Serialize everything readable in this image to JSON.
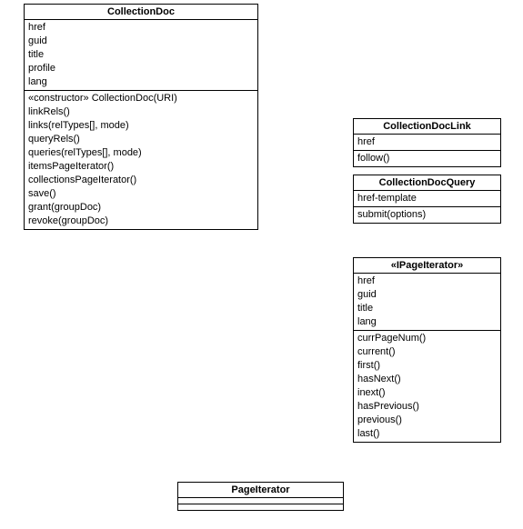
{
  "classes": {
    "collectionDoc": {
      "name": "CollectionDoc",
      "attrs": [
        "href",
        "guid",
        "title",
        "profile",
        "lang"
      ],
      "ops": [
        "«constructor» CollectionDoc(URI)",
        "linkRels()",
        "links(relTypes[], mode)",
        "queryRels()",
        "queries(relTypes[], mode)",
        "itemsPageIterator()",
        "collectionsPageIterator()",
        "save()",
        "grant(groupDoc)",
        "revoke(groupDoc)"
      ]
    },
    "collectionDocLink": {
      "name": "CollectionDocLink",
      "attrs": [
        "href"
      ],
      "ops": [
        "follow()"
      ]
    },
    "collectionDocQuery": {
      "name": "CollectionDocQuery",
      "attrs": [
        "href-template"
      ],
      "ops": [
        "submit(options)"
      ]
    },
    "iPageIterator": {
      "name": "«IPageIterator»",
      "attrs": [
        "href",
        "guid",
        "title",
        "lang"
      ],
      "ops": [
        "currPageNum()",
        "current()",
        "first()",
        "hasNext()",
        "inext()",
        "hasPrevious()",
        "previous()",
        "last()"
      ]
    },
    "pageIterator": {
      "name": "PageIterator",
      "attrs": [],
      "ops": []
    }
  }
}
